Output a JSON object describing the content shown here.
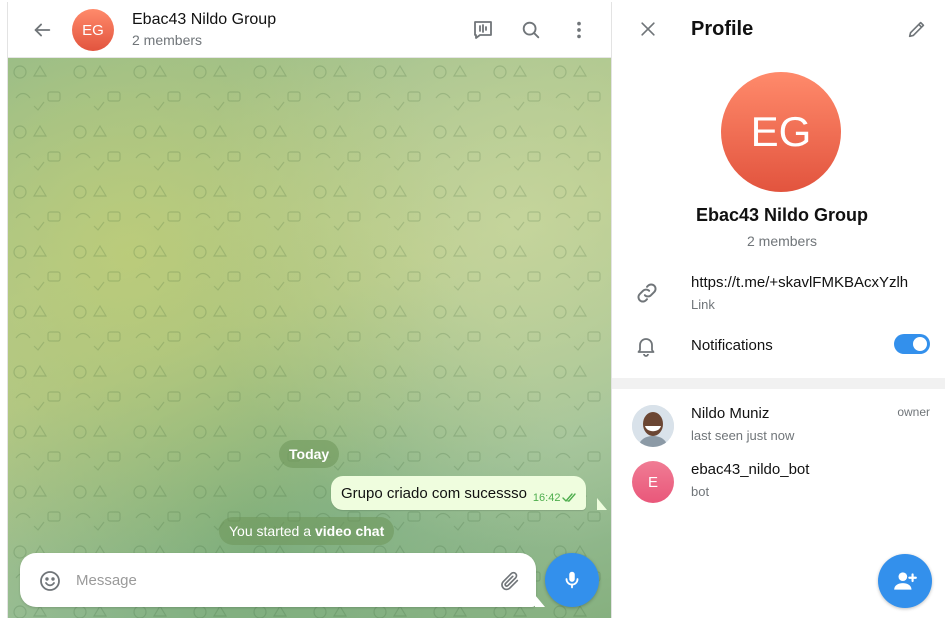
{
  "chat": {
    "avatar_initials": "EG",
    "title": "Ebac43 Nildo Group",
    "subtitle": "2 members",
    "date_label": "Today",
    "messages": [
      {
        "text": "Grupo criado com sucessso",
        "time": "16:42",
        "status": "read"
      }
    ],
    "service_message": {
      "prefix": "You started a",
      "bold": "video chat"
    },
    "composer": {
      "placeholder": "Message"
    }
  },
  "profile": {
    "title": "Profile",
    "avatar_initials": "EG",
    "name": "Ebac43 Nildo Group",
    "subtitle": "2 members",
    "link": {
      "value": "https://t.me/+skavlFMKBAcxYzlh",
      "label": "Link"
    },
    "notifications": {
      "label": "Notifications",
      "enabled": true
    },
    "members": [
      {
        "name": "Nildo Muniz",
        "status": "last seen just now",
        "role": "owner",
        "avatar": "photo"
      },
      {
        "name": "ebac43_nildo_bot",
        "status": "bot",
        "role": "",
        "avatar_initial": "E"
      }
    ]
  },
  "icons": {
    "back": "arrow-left-icon",
    "video_chat": "video-chat-icon",
    "search": "search-icon",
    "more": "more-vertical-icon",
    "close": "close-icon",
    "edit": "pencil-icon",
    "link": "link-icon",
    "bell": "bell-icon",
    "emoji": "smile-icon",
    "attach": "paperclip-icon",
    "mic": "microphone-icon",
    "add_member": "add-user-icon"
  },
  "colors": {
    "accent": "#3390ec",
    "avatar_gradient_top": "#ff8a6b",
    "avatar_gradient_bottom": "#e2543e",
    "bot_avatar": "#e9577a",
    "outgoing_bubble": "#effdde",
    "read_check": "#4fae4e"
  }
}
